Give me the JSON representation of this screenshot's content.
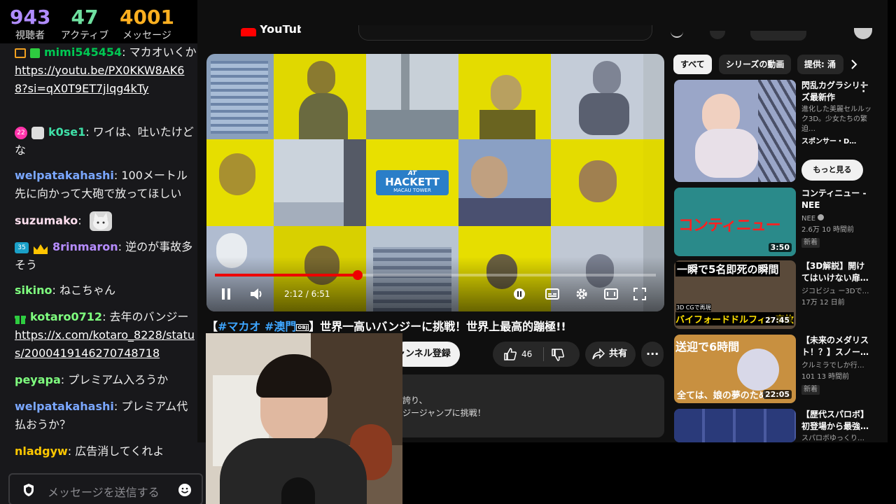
{
  "stats": {
    "viewers": {
      "value": "943",
      "label": "視聴者"
    },
    "active": {
      "value": "47",
      "label": "アクティブ"
    },
    "messages": {
      "value": "4001",
      "label": "メッセージ"
    }
  },
  "chat": {
    "messages": [
      {
        "user": "mimi545454",
        "text": "マカオいくか",
        "link": "https://youtu.be/PX0KKW8AK68?si=qX0T9ET7jlqg4kTy",
        "user_color": "#00c853"
      },
      {
        "user": "k0se1",
        "text": "ワイは、吐いたけどな",
        "badge": "22",
        "user_color": "#3fe0a8"
      },
      {
        "user": "welpatakahashi",
        "text": "100メートル先に向かって大砲で放ってほしい",
        "user_color": "#7aa7ff"
      },
      {
        "user": "suzumako",
        "text": "",
        "user_color": "#ffe0f0"
      },
      {
        "user": "8rinmaron",
        "text": "逆のが事故多そう",
        "badge": "35",
        "user_color": "#b68cff"
      },
      {
        "user": "sikino",
        "text": "ねこちゃん",
        "user_color": "#7fff7f"
      },
      {
        "user": "kotaro0712",
        "text": "去年のバンジー",
        "link": "https://x.com/kotaro_8228/status/2000419146270748718",
        "user_color": "#7fff7f"
      },
      {
        "user": "peyapa",
        "text": "プレミアム入ろうか",
        "user_color": "#7fff7f"
      },
      {
        "user": "welpatakahashi",
        "text": "プレミアム代払おうか？",
        "user_color": "#7aa7ff"
      },
      {
        "user": "nladgyw",
        "text": "広告消してくれよ",
        "user_color": "#ffc800"
      }
    ],
    "input_placeholder": "メッセージを送信する"
  },
  "youtube": {
    "logo_text": "YouTube",
    "player": {
      "time": "2:12 / 6:51",
      "progress": 0.324,
      "brand_top": "AT",
      "brand_main": "HACKETT",
      "brand_sub": "MACAU TOWER"
    },
    "video_title_prefix": "【",
    "video_title_tags": "#マカオ #澳門",
    "video_title_obj": "OBJ",
    "video_title_rest": "】世界一高いバンジーに挑戦！世界上最高的蹦極!!",
    "subscribe_label": "ャンネル登録",
    "like_count": "46",
    "share_label": "共有",
    "description_lines": [
      "誇り、",
      "ジージャンプに挑戦！"
    ],
    "chips": [
      "すべて",
      "シリーズの動画",
      "提供: 涌"
    ],
    "recommended": [
      {
        "title": "閃乱カグラシリーズ最新作",
        "meta1": "進化した美麗セルルック3D。少女たちの繁迫…",
        "meta2": "スポンサー・D…",
        "button": "もっと見る"
      },
      {
        "title": "コンティニュー - NEE",
        "channel": "NEE",
        "meta": "2.6万 10 時間前",
        "badge": "新着",
        "duration": "3:50",
        "thumb_text": "コンティニュー"
      },
      {
        "title": "【3D解説】開けてはいけない扉…",
        "channel": "ジコビジュ ー3Dで…",
        "meta": "17万 12 日前",
        "duration": "27:45",
        "thumb_top": "一瞬で5名即死の瞬間",
        "thumb_label": "3D CGで再現",
        "thumb_bottom": "バイフォードドルフィン事故"
      },
      {
        "title": "【未来のメダリスト！？】スノー…",
        "channel": "クルミラでしか行…",
        "meta": "101 13 時間前",
        "badge": "新着",
        "duration": "22:05",
        "thumb_top": "送迎で6時間",
        "thumb_bottom": "全ては、娘の夢のため"
      },
      {
        "title": "【歴代スパロボ】初登場から最強…",
        "channel": "スパロボゆっくり…"
      }
    ]
  },
  "colors": {
    "accent_red": "#ff0000",
    "link_blue": "#3ea6ff",
    "tile_yellow": "#e8e21a"
  }
}
